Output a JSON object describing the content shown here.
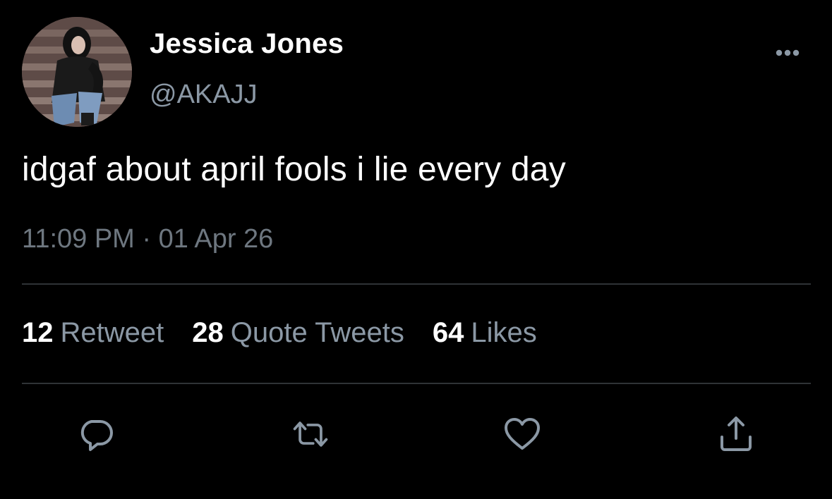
{
  "author": {
    "display_name": "Jessica Jones",
    "handle": "@AKAJJ"
  },
  "tweet": {
    "text": "idgaf about april fools i lie every day",
    "time": "11:09 PM",
    "separator": "·",
    "date": "01 Apr 26"
  },
  "stats": {
    "retweets": {
      "count": "12",
      "label": "Retweet"
    },
    "quotes": {
      "count": "28",
      "label": "Quote Tweets"
    },
    "likes": {
      "count": "64",
      "label": "Likes"
    }
  },
  "icons": {
    "more": "more-horizontal-icon",
    "reply": "reply-icon",
    "retweet": "retweet-icon",
    "like": "heart-icon",
    "share": "share-icon"
  },
  "colors": {
    "background": "#000000",
    "primary_text": "#ffffff",
    "secondary_text": "#8b98a5",
    "divider": "#2f3336"
  }
}
